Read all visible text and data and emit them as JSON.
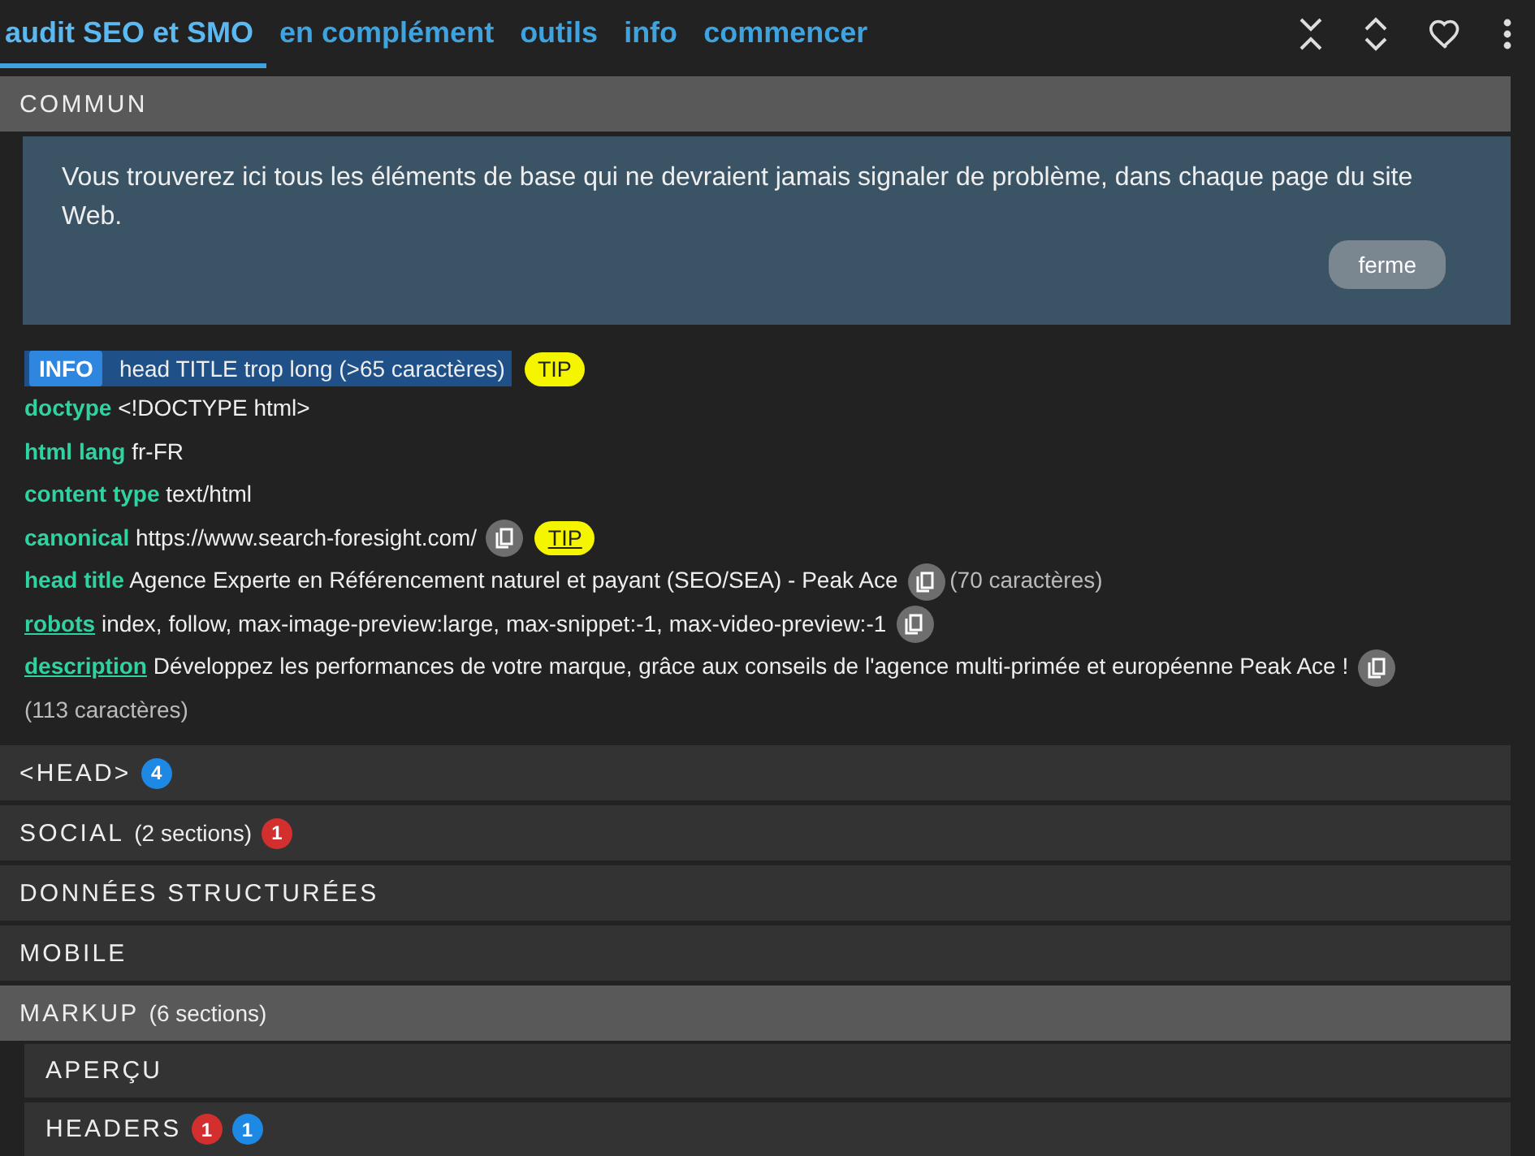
{
  "tabs": [
    {
      "label": "audit SEO et SMO",
      "selected": true
    },
    {
      "label": "en complément",
      "selected": false
    },
    {
      "label": "outils",
      "selected": false
    },
    {
      "label": "info",
      "selected": false
    },
    {
      "label": "commencer",
      "selected": false
    }
  ],
  "toolbar": [
    {
      "kind": "collapse"
    },
    {
      "kind": "expand"
    },
    {
      "kind": "favorite"
    },
    {
      "kind": "menu"
    }
  ],
  "sections": [
    {
      "title": "COMMUN",
      "expanded": true,
      "notice": {
        "text": "Vous trouverez ici tous les éléments de base qui ne devraient jamais signaler de problème, dans chaque page du site Web.",
        "button": "ferme"
      },
      "rows": [
        {
          "kind": "alert",
          "tag": "INFO",
          "text": "head TITLE trop long (>65 caractères)",
          "tip": {
            "label": "TIP",
            "underlined": false
          }
        },
        {
          "kind": "field",
          "label": "doctype",
          "linked": false,
          "value": "<!DOCTYPE html>",
          "copy": false
        },
        {
          "kind": "field",
          "label": "html lang",
          "linked": false,
          "value": "fr-FR",
          "copy": false
        },
        {
          "kind": "field",
          "label": "content type",
          "linked": false,
          "value": "text/html",
          "copy": false
        },
        {
          "kind": "field",
          "label": "canonical",
          "linked": false,
          "value": "https://www.search-foresight.com/",
          "copy": true,
          "tip": {
            "label": "TIP",
            "underlined": true
          }
        },
        {
          "kind": "field",
          "label": "head title",
          "linked": false,
          "value": "Agence Experte en Référencement naturel et payant (SEO/SEA) - Peak Ace",
          "copy": true,
          "note": "(70 caractères)"
        },
        {
          "kind": "field",
          "label": "robots",
          "linked": true,
          "value": "index, follow, max-image-preview:large, max-snippet:-1, max-video-preview:-1",
          "copy": true
        },
        {
          "kind": "field",
          "label": "description",
          "linked": true,
          "value": "Développez les performances de votre marque, grâce aux conseils de l'agence multi-primée et européenne Peak Ace !",
          "copy": true,
          "note": "(113 caractères)"
        }
      ]
    },
    {
      "title": "<HEAD>",
      "expanded": false,
      "badges": [
        {
          "count": "4",
          "color": "#1e88e5"
        }
      ]
    },
    {
      "title": "SOCIAL",
      "suffix": "(2 sections)",
      "expanded": false,
      "badges": [
        {
          "count": "1",
          "color": "#d32f2f"
        }
      ]
    },
    {
      "title": "DONNÉES STRUCTURÉES",
      "expanded": false
    },
    {
      "title": "MOBILE",
      "expanded": false
    },
    {
      "title": "MARKUP",
      "suffix": "(6 sections)",
      "expanded": true,
      "subsections": [
        {
          "title": "APERÇU"
        },
        {
          "title": "HEADERS",
          "badges": [
            {
              "count": "1",
              "color": "#d32f2f"
            },
            {
              "count": "1",
              "color": "#1e88e5"
            }
          ]
        }
      ]
    }
  ]
}
